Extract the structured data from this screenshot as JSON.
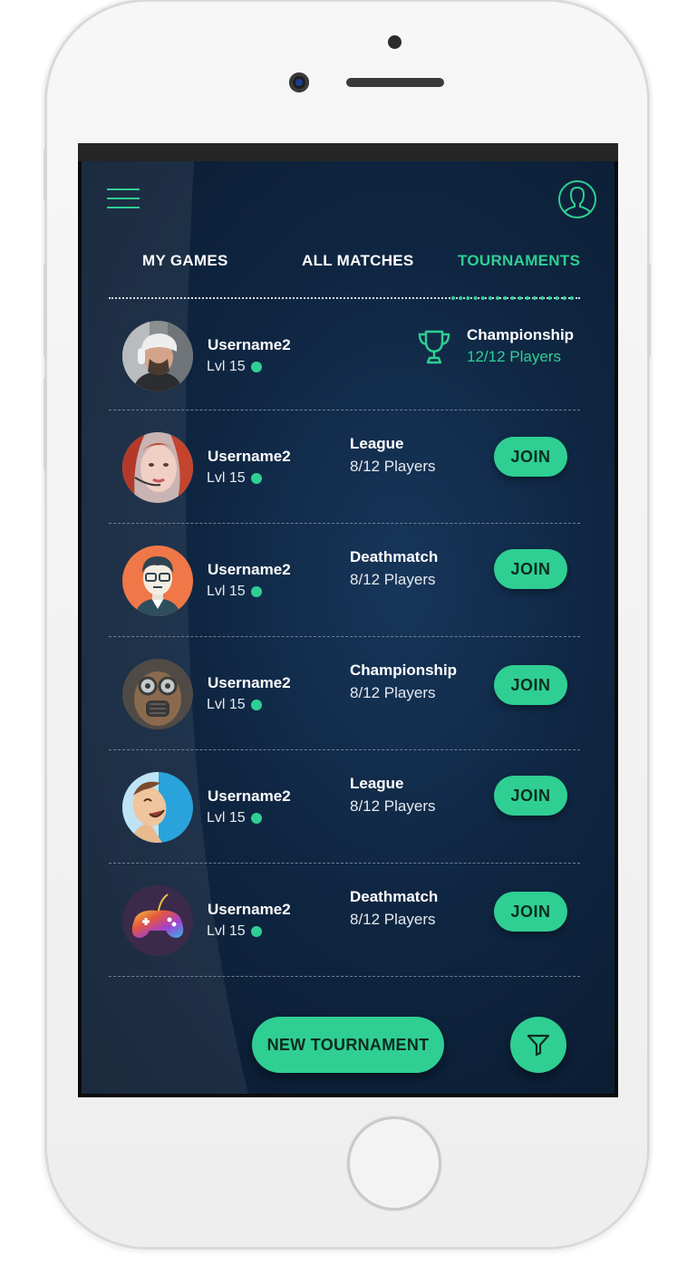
{
  "colors": {
    "accent": "#2fcf93",
    "background": "#0f2642",
    "text": "#ffffff"
  },
  "header": {
    "menu_icon": "hamburger-menu-icon",
    "profile_icon": "user-profile-icon"
  },
  "tabs": [
    {
      "label": "MY GAMES",
      "active": false
    },
    {
      "label": "ALL MATCHES",
      "active": false
    },
    {
      "label": "TOURNAMENTS",
      "active": true
    }
  ],
  "featured": {
    "username": "Username2",
    "level": "Lvl 15",
    "icon": "trophy-icon",
    "type": "Championship",
    "players": "12/12 Players"
  },
  "matches": [
    {
      "username": "Username2",
      "level": "Lvl 15",
      "type": "League",
      "players": "8/12 Players",
      "action": "JOIN"
    },
    {
      "username": "Username2",
      "level": "Lvl 15",
      "type": "Deathmatch",
      "players": "8/12 Players",
      "action": "JOIN"
    },
    {
      "username": "Username2",
      "level": "Lvl 15",
      "type": "Championship",
      "players": "8/12 Players",
      "action": "JOIN"
    },
    {
      "username": "Username2",
      "level": "Lvl 15",
      "type": "League",
      "players": "8/12 Players",
      "action": "JOIN"
    },
    {
      "username": "Username2",
      "level": "Lvl 15",
      "type": "Deathmatch",
      "players": "8/12 Players",
      "action": "JOIN"
    }
  ],
  "actions": {
    "new_tournament": "NEW TOURNAMENT",
    "filter_icon": "filter-funnel-icon"
  }
}
